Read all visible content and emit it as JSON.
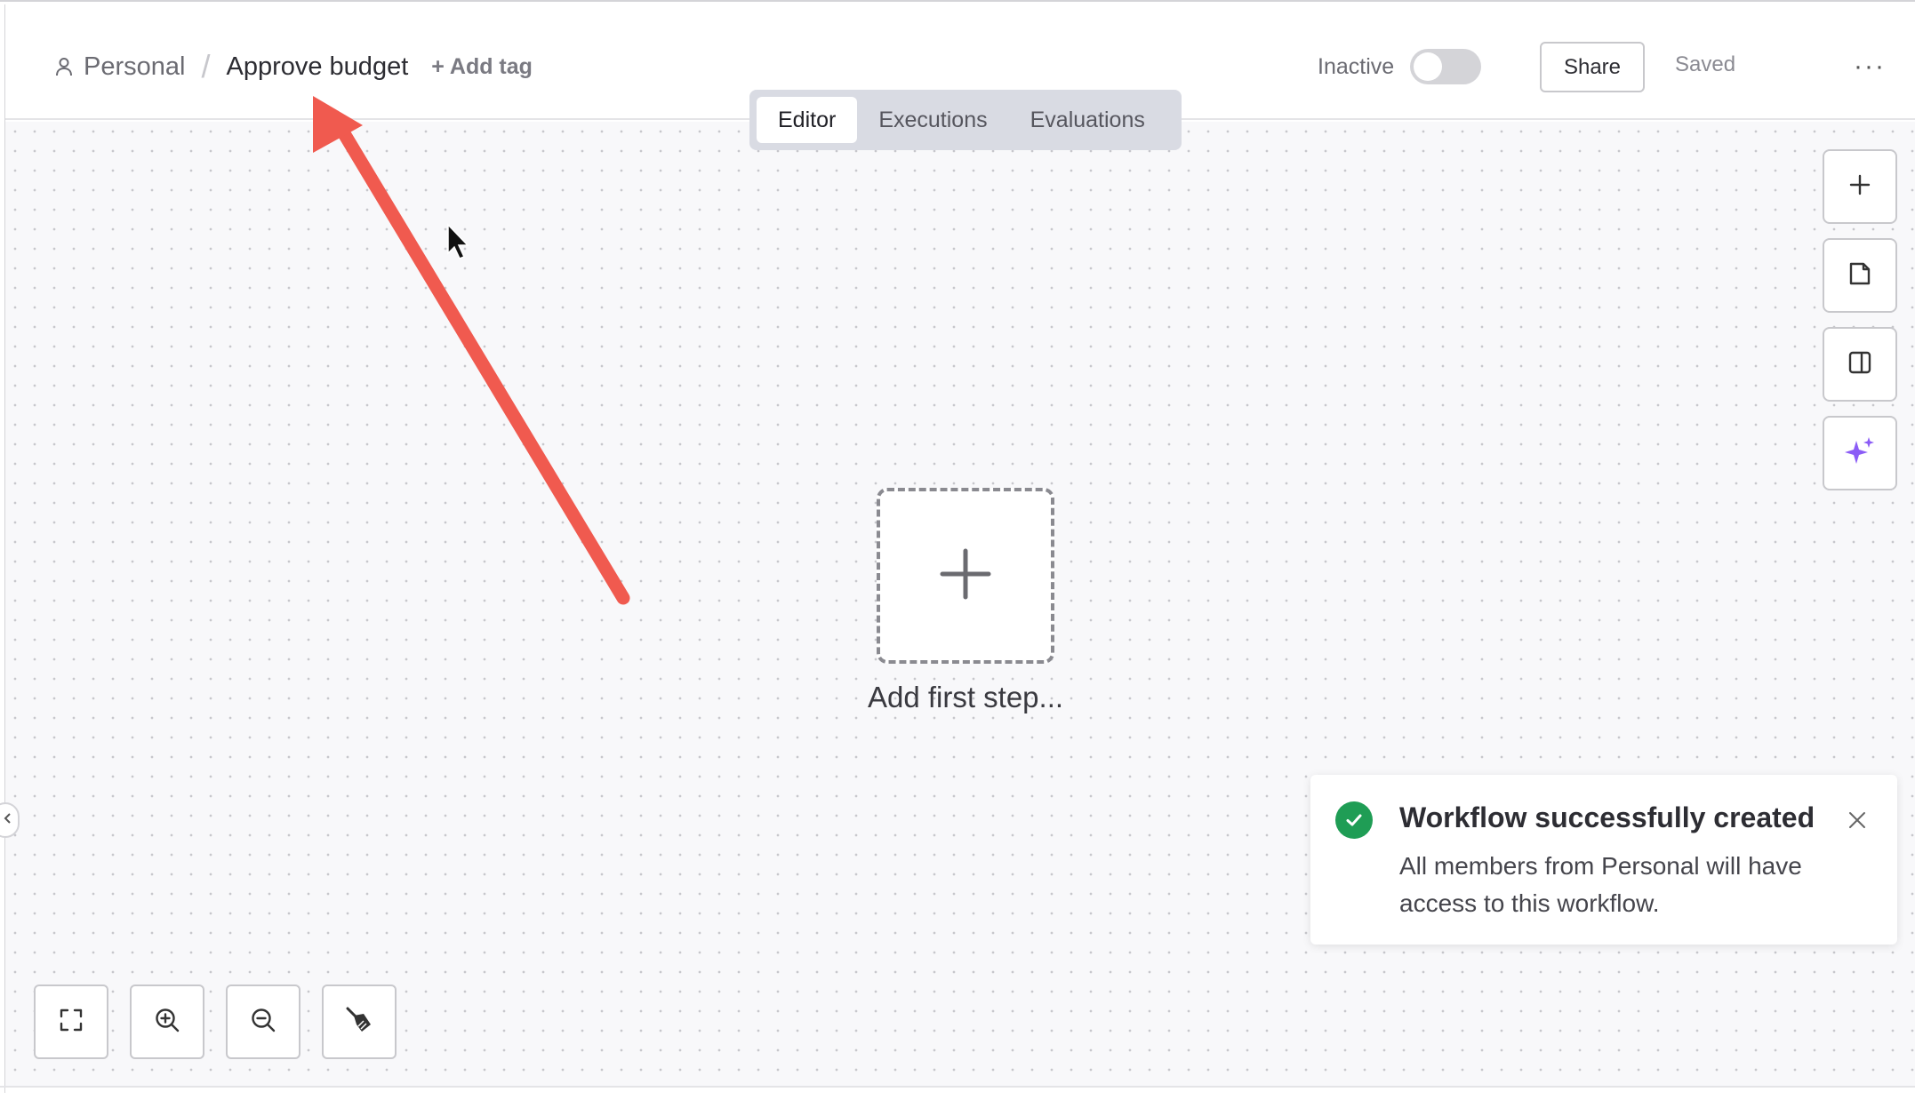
{
  "breadcrumb": {
    "owner_icon": "person-icon",
    "owner": "Personal",
    "separator": "/",
    "workflow_title": "Approve budget",
    "add_tag": "+ Add tag"
  },
  "header": {
    "status_label": "Inactive",
    "active": false,
    "share_label": "Share",
    "save_status": "Saved",
    "more_icon": "ellipsis-icon",
    "more_glyph": "···"
  },
  "tabs": [
    {
      "label": "Editor",
      "active": true
    },
    {
      "label": "Executions",
      "active": false
    },
    {
      "label": "Evaluations",
      "active": false
    }
  ],
  "side_actions": [
    {
      "icon": "plus-icon"
    },
    {
      "icon": "sticky-note-icon"
    },
    {
      "icon": "panel-icon"
    },
    {
      "icon": "sparkle-icon",
      "color": "#8b5cf6"
    }
  ],
  "canvas": {
    "add_first_step_label": "Add first step..."
  },
  "toast": {
    "title": "Workflow successfully created",
    "message": "All members from Personal will have access to this workflow.",
    "status_color": "#1f9d55"
  },
  "zoom_controls": [
    {
      "icon": "fit-view-icon"
    },
    {
      "icon": "zoom-in-icon"
    },
    {
      "icon": "zoom-out-icon"
    },
    {
      "icon": "tidy-up-icon"
    }
  ],
  "annotation": {
    "arrow_color": "#f05a4f"
  }
}
